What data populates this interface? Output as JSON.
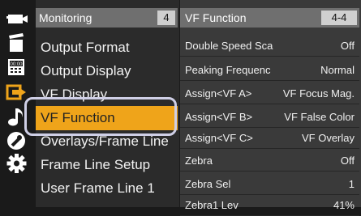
{
  "menu": {
    "title": "Monitoring",
    "page": "4",
    "items": [
      {
        "label": "Output Format"
      },
      {
        "label": "Output Display"
      },
      {
        "label": "VF Display"
      },
      {
        "label": "VF Function"
      },
      {
        "label": "Overlays/Frame Line"
      },
      {
        "label": "Frame Line Setup"
      },
      {
        "label": "User Frame Line 1"
      }
    ],
    "selected_index": 3
  },
  "panel": {
    "title": "VF Function",
    "page": "4-4",
    "rows": [
      {
        "name": "Double Speed Sca",
        "value": "Off"
      },
      {
        "name": "Peaking Frequenc",
        "value": "Normal"
      },
      {
        "name": "Assign<VF A>",
        "value": "VF Focus Mag."
      },
      {
        "name": "Assign<VF B>",
        "value": "VF False Color"
      },
      {
        "name": "Assign<VF C>",
        "value": "VF Overlay"
      },
      {
        "name": "Zebra",
        "value": "Off"
      },
      {
        "name": "Zebra Sel",
        "value": "1"
      },
      {
        "name": "Zebra1 Lev",
        "value": "41%"
      }
    ]
  },
  "icons": [
    "camera-icon",
    "clapperboard-icon",
    "tc-clock-icon",
    "output-icon",
    "music-note-icon",
    "wrench-icon",
    "gear-icon"
  ],
  "colors": {
    "accent": "#efa41a",
    "output_icon": "#efa41a",
    "header": "#6f6f6f"
  }
}
